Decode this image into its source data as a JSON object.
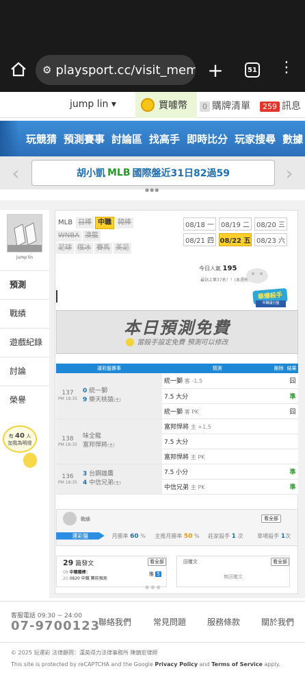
{
  "browser": {
    "url": "playsport.cc/visit_memb",
    "tab_count": "51",
    "home_icon": "home-icon",
    "plus_icon": "plus-icon",
    "menu_icon": "kebab-menu-icon"
  },
  "userbar": {
    "username": "jump lin ▾",
    "coin_label": "買噱幣",
    "cart_count": "0",
    "cart_label": "購牌清單",
    "msg_count": "259",
    "msg_label": "訊息"
  },
  "nav": [
    "玩競猜",
    "預測賽事",
    "討論區",
    "找高手",
    "即時比分",
    "玩家搜尋",
    "數據"
  ],
  "marquee": {
    "prefix": "胡小凱",
    "mid": "MLB",
    "suffix": "國際盤近31日82過59"
  },
  "profile": {
    "name": "jump lin"
  },
  "side_menu": [
    "預測",
    "戰績",
    "遊戲紀錄",
    "討論",
    "榮譽"
  ],
  "side_popup": {
    "prefix": "有",
    "count": "40",
    "suffix": "人",
    "line2": "加我為明燈"
  },
  "leagues": [
    {
      "label": "MLB",
      "state": "plain"
    },
    {
      "label": "日棒",
      "state": "off"
    },
    {
      "label": "中職",
      "state": "active"
    },
    {
      "label": "韓棒",
      "state": "off"
    },
    {
      "label": "WNBA",
      "state": "off"
    },
    {
      "label": "澳籃",
      "state": "off"
    },
    {
      "label": "足球",
      "state": "off"
    },
    {
      "label": "俄冰",
      "state": "off"
    },
    {
      "label": "賽馬",
      "state": "off"
    },
    {
      "label": "美足",
      "state": "off"
    }
  ],
  "dates": [
    {
      "label": "08/18 一",
      "state": "normal"
    },
    {
      "label": "08/19 二",
      "state": "normal"
    },
    {
      "label": "08/20 三",
      "state": "normal"
    },
    {
      "label": "08/21 四",
      "state": "normal"
    },
    {
      "label": "08/22 五",
      "state": "active"
    },
    {
      "label": "08/23 六",
      "state": "normal"
    }
  ],
  "popularity": {
    "label": "今日人氣",
    "value": "195",
    "rank_note": "最站上第37名！！(本週榜)"
  },
  "badge": {
    "title": "華爆殺手",
    "sub": "中職讓分盤"
  },
  "free_banner": {
    "title": "本日預測免費",
    "subtitle": "當殺手設定免費 預測可以修改"
  },
  "table": {
    "headers": [
      "運彩盤賽事",
      "預測",
      "刪除",
      "結果"
    ],
    "games": [
      {
        "num": "137",
        "time": "PM 18:35",
        "away_score": "0",
        "away": "統一獅",
        "home_score": "9",
        "home": "樂天桃猿",
        "home_tag": "(主)",
        "preds": [
          {
            "text": "統一獅",
            "note": "客 -1.5",
            "result": "囧"
          },
          {
            "text": "7.5 大分",
            "note": "",
            "result": "準"
          },
          {
            "text": "統一獅",
            "note": "客 PK",
            "result": "囧"
          }
        ]
      },
      {
        "num": "138",
        "time": "PM 18:35",
        "away_score": "",
        "away": "味全龍",
        "home_score": "",
        "home": "富邦悍將",
        "home_tag": "(主)",
        "preds": [
          {
            "text": "富邦悍將",
            "note": "主 +1.5",
            "result": ""
          },
          {
            "text": "7.5 大分",
            "note": "",
            "result": ""
          },
          {
            "text": "富邦悍將",
            "note": "主 PK",
            "result": ""
          }
        ]
      },
      {
        "num": "136",
        "time": "PM 18:35",
        "away_score": "3",
        "away": "台鋼雄鷹",
        "home_score": "4",
        "home": "中信兄弟",
        "home_tag": "(主)",
        "preds": [
          {
            "text": "7.5 小分",
            "note": "",
            "result": "準"
          },
          {
            "text": "中信兄弟",
            "note": "主 PK",
            "result": "準"
          }
        ]
      }
    ]
  },
  "stats": {
    "title": "戰績",
    "all": "看全部",
    "tab": "運彩盤",
    "monthly_label": "月勝率",
    "monthly": "60",
    "main_label": "主推月勝率",
    "main": "50",
    "kill_label": "莊家殺手",
    "kill": "1",
    "single_label": "單場殺手",
    "single": "1",
    "unit_pct": "%",
    "unit_times": "次"
  },
  "articles": {
    "count": "29",
    "label": "篇發文",
    "all": "看全部",
    "item_date": "08",
    "item_sub": "20",
    "item_title": "中職職棒：",
    "item_desc": "0820 中職 賽前預測",
    "vote_label": "推",
    "vote_count": "5"
  },
  "replies": {
    "title": "回覆文",
    "all": "看全部",
    "empty": "無回覆文"
  },
  "footer": {
    "svc_label": "客服電話 09:30 ~ 24:00",
    "phone": "07-9700123",
    "links": [
      "聯絡我們",
      "常見問題",
      "服務條款",
      "關於我們"
    ],
    "copyright": "© 2025 玩運彩 法律顧問：漢英得力法律事務所 陳鎮宏律師",
    "recaptcha_pre": "This site is protected by reCAPTCHA and the Google",
    "privacy": "Privacy Policy",
    "and": "and",
    "terms": "Terms of Service",
    "apply": "apply."
  }
}
